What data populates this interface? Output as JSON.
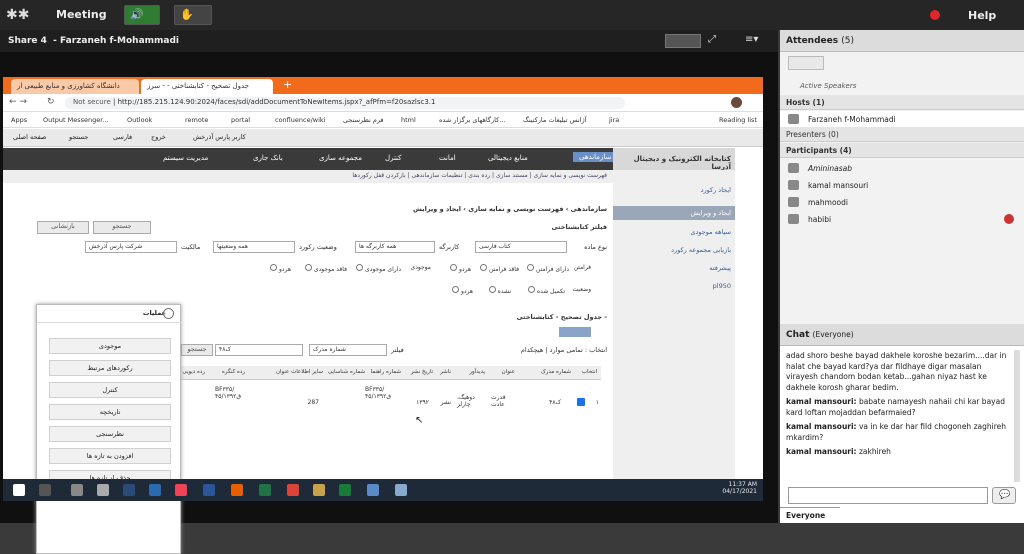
{
  "connect": {
    "meeting_label": "Meeting",
    "help_label": "Help"
  },
  "share": {
    "title": "Share 4",
    "presenter": "Farzaneh f-Mohammadi"
  },
  "attendees": {
    "title": "Attendees",
    "count": "(5)",
    "active_speakers": "Active Speakers",
    "hosts_label": "Hosts (1)",
    "host": "Farzaneh f-Mohammadi",
    "presenters_label": "Presenters (0)",
    "participants_label": "Participants (4)",
    "participants": [
      "Amininasab",
      "kamal mansouri",
      "mahmoodi",
      "habibi"
    ]
  },
  "chat": {
    "title": "Chat",
    "scope": "(Everyone)",
    "tab": "Everyone",
    "lines": [
      {
        "who": "",
        "text": "adad shoro beshe bayad dakhele koroshe bezarim....dar in halat che bayad kard?ya dar fildhaye digar masalan virayesh chandom bodan ketab...gahan niyaz hast ke dakhele korosh gharar bedim."
      },
      {
        "who": "kamal mansouri:",
        "text": "babate namayesh nahaii chi kar bayad kard loftan mojaddan befarmaied?"
      },
      {
        "who": "kamal mansouri:",
        "text": "va in ke dar har fild chogoneh zaghireh mkardim?"
      },
      {
        "who": "kamal mansouri:",
        "text": "zakhireh"
      }
    ]
  },
  "browser": {
    "tab1": "دانشگاه کشاورزی و منابع طبیعی ار",
    "tab2": "جدول تصحیح - کتابشناختی - - سرز",
    "not_secure": "Not secure",
    "url": "http://185.215.124.90:2024/faces/sdi/addDocumentToNewItems.jspx?_afPfm=f20sazlsc3.1",
    "bookmarks": [
      "Apps",
      "Output Messenger...",
      "Outlook",
      "remote",
      "portal",
      "confluence/wiki",
      "فرم نظرسنجی",
      "html",
      "کارگاههای برگزار شده...",
      "آژانس تبلیغات مارکتینگ",
      "jira",
      "Reading list"
    ]
  },
  "app": {
    "brand": "کتابخانه الکترونیک و دیجیتال آذرسا",
    "toolbar": [
      "صفحه اصلی",
      "جستجو",
      "فارسی",
      "خروج",
      "کاربر پارس آذرخش"
    ],
    "nav": [
      "سازماندهی",
      "منابع دیجیتالی",
      "امانت",
      "کنترل",
      "مجموعه سازی",
      "بانک جاری",
      "مدیریت سیستم"
    ],
    "subnav": "فهرست نویسی و نمایه سازی | مستند سازی | رده بندی | تنظیمات سازماندهی | بازکردن قفل رکوردها",
    "side": [
      "ایجاد رکورد",
      "ایجاد و ویرایش",
      "سیاهه موجودی",
      "بازیابی مجموعه رکورد",
      "پیشرفته",
      "pl950"
    ],
    "breadcrumb": "سازماندهی › فهرست نویسی و نمایه سازی › ایجاد و ویرایش",
    "filter_title": "فیلتر کتابشناختی",
    "search_btn": "جستجو",
    "reset_btn": "بازنشانی",
    "lbl_type": "نوع ماده",
    "type_val": "کتاب فارسی",
    "lbl_user": "کاربرگه",
    "user_val": "همه کاربرگه ها",
    "lbl_status": "وضعیت رکورد",
    "status_val": "همه وضعیتها",
    "lbl_owner": "مالکیت",
    "owner_val": "شرکت پارس آذرخش",
    "radios1": [
      "فرامتن",
      "دارای فرامتن",
      "فاقد فرامتن",
      "هردو",
      "موجودی",
      "دارای موجودی",
      "فاقد موجودی",
      "هردو"
    ],
    "radios2": [
      "وضعیت",
      "تکمیل شده",
      "نشده",
      "هردو"
    ],
    "grid_title": "جدول تصحیح - کتابشناختی -",
    "select_label": "انتخاب : تمامی موارد | هیچکدام",
    "filter_lbl": "فیلتر",
    "filter_field": "شماره مدرک",
    "filter_val": "۴۸ک",
    "grid_search": "جستجو",
    "cols": [
      "انتخاب",
      "شماره مدرک",
      "عنوان",
      "پدیدآور",
      "ناشر",
      "تاریخ نشر",
      "شماره راهنما",
      "شماره شناسایی",
      "سایر اطلاعات عنوان",
      "رده کنگره",
      "رده دیویی"
    ],
    "row": {
      "num": "۱",
      "doc": "۴۸ک",
      "title": "قدرت عادت",
      "author": "دوهیگ، چارلز",
      "publisher": "نشر",
      "date": "۱۳۹۲",
      "guide": "BF۳۳۵/ق۴۵/۱۳۹۲",
      "id": "287",
      "congress": "BF۳۳۵/ق۴۵/۱۳۹۲"
    }
  },
  "popup": {
    "title": "عملیات",
    "items": [
      "موجودی",
      "رکوردهای مرتبط",
      "کنترل",
      "تاریخچه",
      "نظرسنجی",
      "افزودن به تازه ها",
      "حذف از تازه ها"
    ]
  },
  "taskbar": {
    "time": "11:37 AM",
    "date": "04/17/2021"
  }
}
